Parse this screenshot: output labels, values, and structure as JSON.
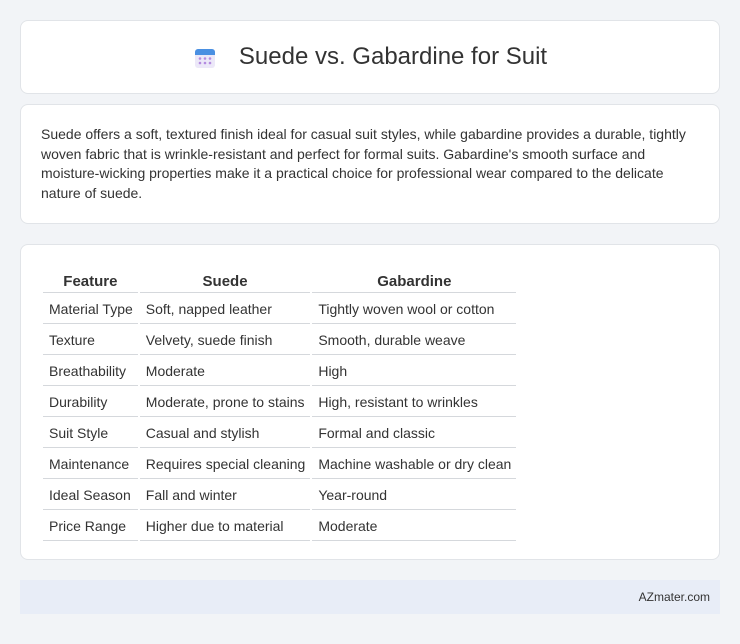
{
  "header": {
    "title": "Suede vs. Gabardine for Suit",
    "icon": "calendar-icon"
  },
  "description": "Suede offers a soft, textured finish ideal for casual suit styles, while gabardine provides a durable, tightly woven fabric that is wrinkle-resistant and perfect for formal suits. Gabardine's smooth surface and moisture-wicking properties make it a practical choice for professional wear compared to the delicate nature of suede.",
  "table": {
    "headers": [
      "Feature",
      "Suede",
      "Gabardine"
    ],
    "rows": [
      [
        "Material Type",
        "Soft, napped leather",
        "Tightly woven wool or cotton"
      ],
      [
        "Texture",
        "Velvety, suede finish",
        "Smooth, durable weave"
      ],
      [
        "Breathability",
        "Moderate",
        "High"
      ],
      [
        "Durability",
        "Moderate, prone to stains",
        "High, resistant to wrinkles"
      ],
      [
        "Suit Style",
        "Casual and stylish",
        "Formal and classic"
      ],
      [
        "Maintenance",
        "Requires special cleaning",
        "Machine washable or dry clean"
      ],
      [
        "Ideal Season",
        "Fall and winter",
        "Year-round"
      ],
      [
        "Price Range",
        "Higher due to material",
        "Moderate"
      ]
    ]
  },
  "footer": {
    "brand": "AZmater.com"
  },
  "colors": {
    "icon_top": "#4a90e2",
    "icon_body": "#e8e4f7",
    "icon_dots": "#b48be0"
  }
}
